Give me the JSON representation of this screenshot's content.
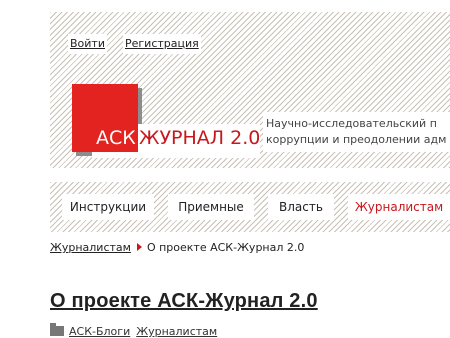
{
  "header": {
    "login_label": "Войти",
    "register_label": "Регистрация",
    "logo": {
      "part1": "АСК",
      "part2": "ЖУРНАЛ 2.0"
    },
    "tagline_line1": "Научно-исследовательский п",
    "tagline_line2": "коррупции и преодолении адм"
  },
  "nav": {
    "items": [
      {
        "label": "Инструкции"
      },
      {
        "label": "Приемные"
      },
      {
        "label": "Власть"
      },
      {
        "label": "Журналистам"
      }
    ],
    "active_color": "#c9171c"
  },
  "breadcrumb": {
    "parent": "Журналистам",
    "current": "О проекте АСК-Журнал 2.0"
  },
  "page": {
    "title": "О проекте АСК-Журнал 2.0",
    "categories": [
      "АСК-Блоги",
      "Журналистам"
    ]
  },
  "colors": {
    "brand_red": "#e3231f",
    "hatch": "#c9c2b6"
  }
}
